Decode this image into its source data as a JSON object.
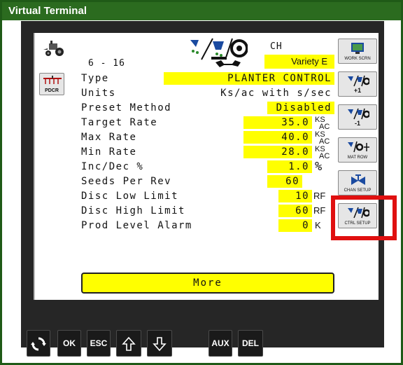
{
  "window": {
    "title": "Virtual Terminal"
  },
  "header": {
    "index": "6 - 16",
    "channel": "CH",
    "variety": "Variety E"
  },
  "left_buttons": {
    "pdcr_label": "PDCR"
  },
  "rows": [
    {
      "label": "Type",
      "value": "PLANTER CONTROL",
      "unit": ""
    },
    {
      "label": "Units",
      "value": "Ks/ac with s/sec",
      "unit": ""
    },
    {
      "label": "Preset Method",
      "value": "Disabled",
      "unit": ""
    },
    {
      "label": "Target Rate",
      "value": "35.0",
      "unit_top": "KS",
      "unit_bottom": "AC"
    },
    {
      "label": "Max Rate",
      "value": "40.0",
      "unit_top": "KS",
      "unit_bottom": "AC"
    },
    {
      "label": "Min Rate",
      "value": "28.0",
      "unit_top": "KS",
      "unit_bottom": "AC"
    },
    {
      "label": "Inc/Dec %",
      "value": "1.0",
      "unit": "%"
    },
    {
      "label": "Seeds Per Rev",
      "value": "60",
      "unit": ""
    },
    {
      "label": "Disc Low Limit",
      "value": "10",
      "unit": "RF"
    },
    {
      "label": "Disc High Limit",
      "value": "60",
      "unit": "RF"
    },
    {
      "label": "Prod Level Alarm",
      "value": "0",
      "unit": "K"
    }
  ],
  "more_button": "More",
  "softkeys": [
    {
      "label": "WORK SCRN"
    },
    {
      "label": "+1"
    },
    {
      "label": "-1"
    },
    {
      "label": "MAT ROW"
    },
    {
      "label": "CHAN SETUP"
    },
    {
      "label": "CTRL SETUP"
    }
  ],
  "hardkeys": {
    "ok": "OK",
    "esc": "ESC",
    "aux": "AUX",
    "del": "DEL"
  },
  "colors": {
    "field_yellow": "#ffff00",
    "title_green": "#2b6b1f",
    "highlight_red": "#e01010"
  }
}
